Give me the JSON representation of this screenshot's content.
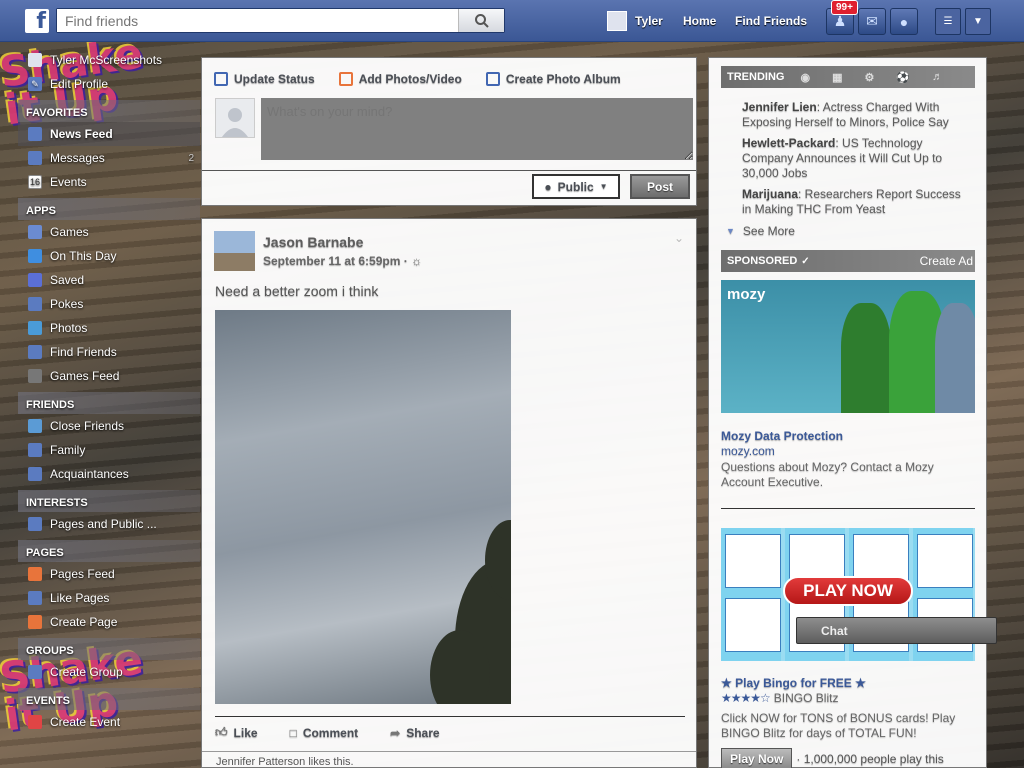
{
  "topbar": {
    "search_placeholder": "Find friends",
    "user_name": "Tyler",
    "home": "Home",
    "find_friends": "Find Friends",
    "notification_badge": "99+"
  },
  "left_nav": {
    "profile_name": "Tyler McScreenshots",
    "edit_profile": "Edit Profile",
    "sections": [
      {
        "heading": "FAVORITES",
        "items": [
          {
            "label": "News Feed",
            "icon": "news-feed-icon",
            "color": "#5b7bc0",
            "active": true
          },
          {
            "label": "Messages",
            "icon": "messages-icon",
            "color": "#5b7bc0",
            "count": "2"
          },
          {
            "label": "Events",
            "icon": "events-icon",
            "color": "#ffffff",
            "glyph": "16"
          }
        ]
      },
      {
        "heading": "APPS",
        "items": [
          {
            "label": "Games",
            "icon": "games-icon",
            "color": "#6b8bd1"
          },
          {
            "label": "On This Day",
            "icon": "on-this-day-icon",
            "color": "#3f8ee0"
          },
          {
            "label": "Saved",
            "icon": "saved-icon",
            "color": "#5b6fd6"
          },
          {
            "label": "Pokes",
            "icon": "pokes-icon",
            "color": "#5b7bc0"
          },
          {
            "label": "Photos",
            "icon": "photos-icon",
            "color": "#4a9bd8"
          },
          {
            "label": "Find Friends",
            "icon": "find-friends-icon",
            "color": "#5b7bc0"
          },
          {
            "label": "Games Feed",
            "icon": "games-feed-icon",
            "color": "#777777"
          }
        ]
      },
      {
        "heading": "FRIENDS",
        "items": [
          {
            "label": "Close Friends",
            "icon": "close-friends-icon",
            "color": "#5b9bd5"
          },
          {
            "label": "Family",
            "icon": "family-icon",
            "color": "#5b7bc0"
          },
          {
            "label": "Acquaintances",
            "icon": "acquaintances-icon",
            "color": "#5b7bc0"
          }
        ]
      },
      {
        "heading": "INTERESTS",
        "items": [
          {
            "label": "Pages and Public ...",
            "icon": "pages-feed-rss-icon",
            "color": "#5b7bc0"
          }
        ]
      },
      {
        "heading": "PAGES",
        "items": [
          {
            "label": "Pages Feed",
            "icon": "pages-feed-icon",
            "color": "#e8743b"
          },
          {
            "label": "Like Pages",
            "icon": "like-pages-icon",
            "color": "#5b7bc0"
          },
          {
            "label": "Create Page",
            "icon": "create-page-icon",
            "color": "#e8743b"
          }
        ]
      },
      {
        "heading": "GROUPS",
        "items": [
          {
            "label": "Create Group",
            "icon": "create-group-icon",
            "color": "#5b7bc0"
          }
        ]
      },
      {
        "heading": "EVENTS",
        "items": [
          {
            "label": "Create Event",
            "icon": "create-event-icon",
            "color": "#e04545"
          }
        ]
      }
    ]
  },
  "composer": {
    "tab_status": "Update Status",
    "tab_photos": "Add Photos/Video",
    "tab_album": "Create Photo Album",
    "placeholder": "What's on your mind?",
    "privacy": "Public",
    "post": "Post"
  },
  "story": {
    "author": "Jason Barnabe",
    "timestamp": "September 11 at 6:59pm · ",
    "text": "Need a better zoom i think",
    "like": "Like",
    "comment": "Comment",
    "share": "Share",
    "social_line": "Jennifer Patterson likes this."
  },
  "trending": {
    "heading": "TRENDING",
    "items": [
      {
        "topic": "Jennifer Lien",
        "desc": ": Actress Charged With Exposing Herself to Minors, Police Say"
      },
      {
        "topic": "Hewlett-Packard",
        "desc": ": US Technology Company Announces it Will Cut Up to 30,000 Jobs"
      },
      {
        "topic": "Marijuana",
        "desc": ": Researchers Report Success in Making THC From Yeast"
      }
    ],
    "see_more": "See More"
  },
  "sponsored": {
    "heading": "SPONSORED",
    "create_ad": "Create Ad",
    "ad1": {
      "logo": "mozy",
      "title": "Mozy Data Protection",
      "url": "mozy.com",
      "desc": "Questions about Mozy? Contact a Mozy Account Executive."
    },
    "ad2": {
      "banner_cta": "PLAY NOW",
      "title": "Play Bingo for FREE",
      "rating_stars": 4.5,
      "brand": "BINGO Blitz",
      "desc": "Click NOW for TONS of BONUS cards! Play BINGO Blitz for days of TOTAL FUN!",
      "cta": "Play Now",
      "social": "· 1,000,000 people play this"
    }
  },
  "chat": {
    "label": "Chat"
  },
  "colors": {
    "brand": "#3b5998",
    "topbar": "#3b5795"
  }
}
